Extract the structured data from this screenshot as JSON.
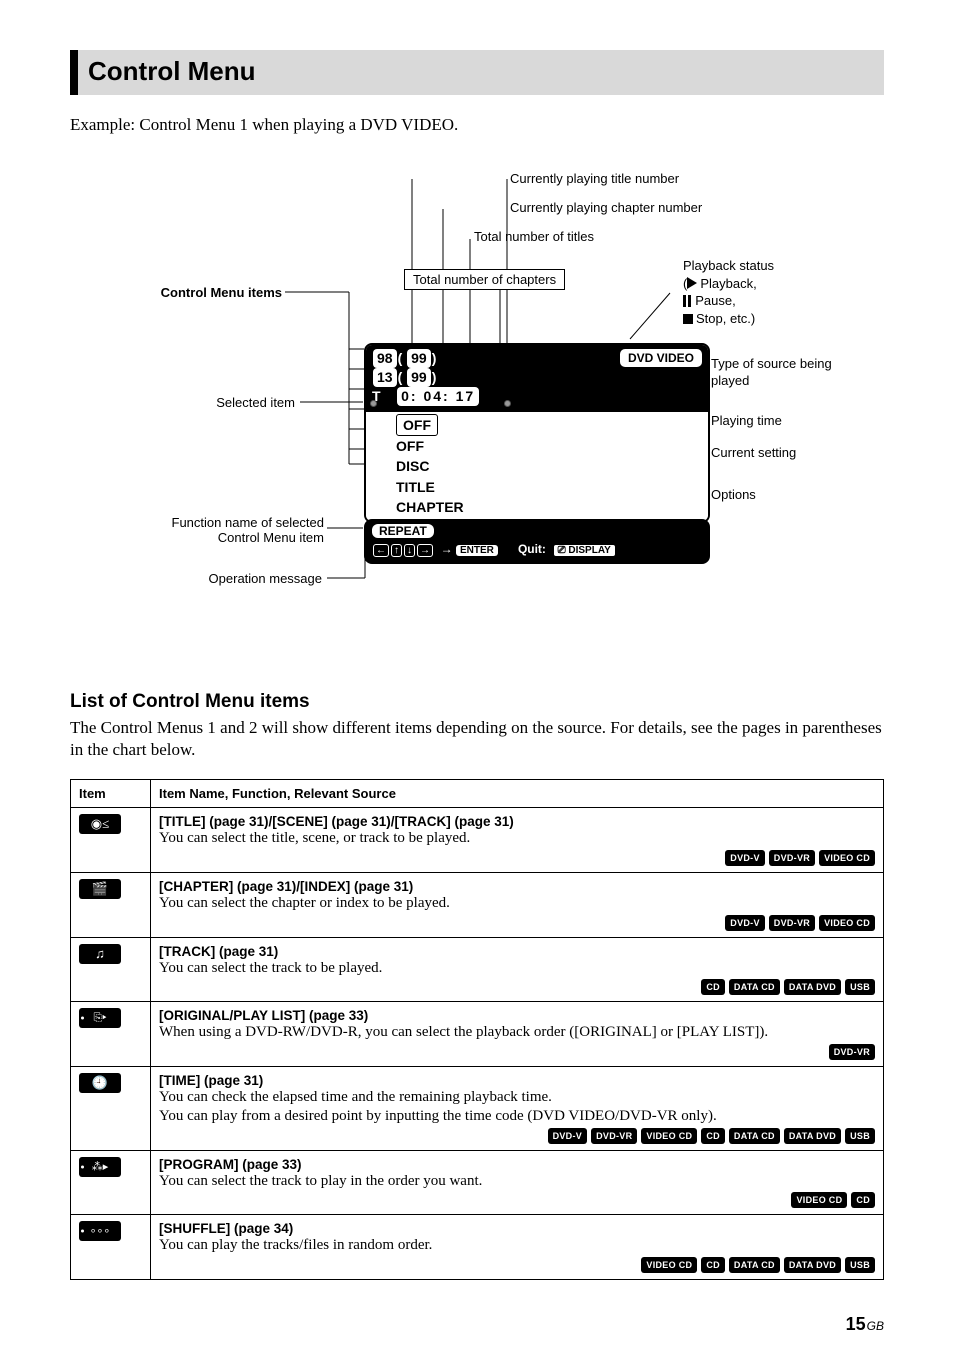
{
  "section_title": "Control Menu",
  "example_text": "Example: Control Menu 1 when playing a DVD VIDEO.",
  "diagram": {
    "labels": {
      "control_menu_items": "Control Menu items",
      "selected_item": "Selected item",
      "func_name_line1": "Function name of selected",
      "func_name_line2": "Control Menu item",
      "operation_message": "Operation message",
      "curr_title": "Currently playing title number",
      "curr_chapter": "Currently playing chapter number",
      "total_titles": "Total number of titles",
      "total_chapters": "Total number of chapters",
      "playback_status_head": "Playback status",
      "playback_status_play": "Playback,",
      "playback_status_pause": "Pause,",
      "playback_status_stop": "Stop, etc.)",
      "type_source": "Type of source being played",
      "playing_time": "Playing time",
      "current_setting": "Current setting",
      "options": "Options"
    },
    "osd": {
      "title_cur": "98",
      "title_total": "99",
      "chapter_cur": "13",
      "chapter_total": "99",
      "time_label": "T",
      "time_value": "0: 04: 17",
      "source": "DVD VIDEO",
      "rows": [
        "OFF",
        "OFF",
        "DISC",
        "TITLE",
        "CHAPTER"
      ],
      "func_name": "REPEAT",
      "enter_label": "ENTER",
      "quit_label": "Quit:",
      "display_label": "DISPLAY"
    }
  },
  "list_heading": "List of Control Menu items",
  "list_text": "The Control Menus 1 and 2 will show different items depending on the source. For details, see the pages in parentheses in the chart below.",
  "table": {
    "head_item": "Item",
    "head_desc": "Item Name, Function, Relevant Source",
    "rows": [
      {
        "icon_glyph": "◉≤",
        "dot": false,
        "title": "[TITLE] (page 31)/[SCENE] (page 31)/[TRACK] (page 31)",
        "desc": "You can select the title, scene, or track to be played.",
        "badges": [
          "DVD-V",
          "DVD-VR",
          "VIDEO CD"
        ],
        "inline_badges": true
      },
      {
        "icon_glyph": "🎬",
        "dot": false,
        "title": "[CHAPTER] (page 31)/[INDEX] (page 31)",
        "desc": "You can select the chapter or index to be played.",
        "badges": [
          "DVD-V",
          "DVD-VR",
          "VIDEO CD"
        ],
        "inline_badges": true
      },
      {
        "icon_glyph": "♫",
        "dot": false,
        "title": "[TRACK] (page 31)",
        "desc": "You can select the track to be played.",
        "badges": [
          "CD",
          "DATA CD",
          "DATA DVD",
          "USB"
        ],
        "inline_badges": true
      },
      {
        "icon_glyph": "⎘▸",
        "dot": true,
        "title": "[ORIGINAL/PLAY LIST] (page 33)",
        "desc": "When using a DVD-RW/DVD-R, you can select the playback order ([ORIGINAL] or [PLAY LIST]).",
        "badges": [
          "DVD-VR"
        ],
        "inline_badges": true
      },
      {
        "icon_glyph": "🕘",
        "dot": false,
        "title": "[TIME] (page 31)",
        "desc": "You can check the elapsed time and the remaining playback time.\nYou can play from a desired point by inputting the time code (DVD VIDEO/DVD-VR only).",
        "badges": [
          "DVD-V",
          "DVD-VR",
          "VIDEO CD",
          "CD",
          "DATA CD",
          "DATA DVD",
          "USB"
        ],
        "inline_badges": false
      },
      {
        "icon_glyph": "⁂▸",
        "dot": true,
        "title": "[PROGRAM] (page 33)",
        "desc": "You can select the track to play in the order you want.",
        "badges": [
          "VIDEO CD",
          "CD"
        ],
        "inline_badges": true
      },
      {
        "icon_glyph": "∘∘∘",
        "dot": true,
        "title": "[SHUFFLE] (page 34)",
        "desc": "You can play the tracks/files in random order.",
        "badges": [
          "VIDEO CD",
          "CD",
          "DATA CD",
          "DATA DVD",
          "USB"
        ],
        "inline_badges": false
      }
    ]
  },
  "page_number": "15",
  "page_suffix": "GB"
}
